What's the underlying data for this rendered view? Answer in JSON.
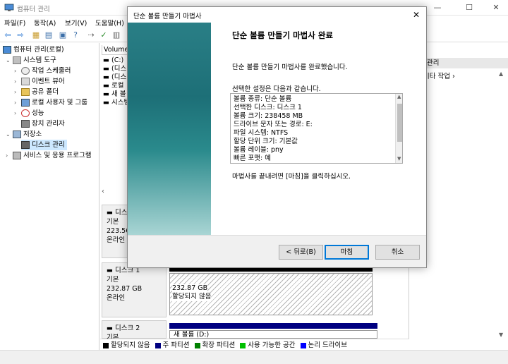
{
  "window": {
    "title": "컴퓨터 관리",
    "controls": [
      "—",
      "☐",
      "✕"
    ]
  },
  "menu": [
    "파일(F)",
    "동작(A)",
    "보기(V)",
    "도움말(H)"
  ],
  "tree": {
    "root": "컴퓨터 관리(로컬)",
    "system_tools": "시스템 도구",
    "task_scheduler": "작업 스케줄러",
    "event_viewer": "이벤트 뷰어",
    "shared_folders": "공유 폴더",
    "local_users": "로컬 사용자 및 그룹",
    "performance": "성능",
    "device_manager": "장치 관리자",
    "storage": "저장소",
    "disk_management": "디스크 관리",
    "services_apps": "서비스 및 응용 프로그램"
  },
  "center": {
    "volume_header": "Volume",
    "volumes": [
      "(C:)",
      "(디스",
      "(디스",
      "로컬",
      "새 볼",
      "시스템"
    ],
    "disk0": {
      "name": "디스",
      "type": "기본",
      "size": "223.56",
      "status": "온라인"
    },
    "disk1": {
      "name": "디스크 1",
      "type": "기본",
      "size": "232.87 GB",
      "status": "온라인",
      "part_size": "232.87 GB",
      "part_status": "할당되지 않음"
    },
    "disk2": {
      "name": "디스크 2",
      "type": "기본",
      "part_label": "새 볼륨  (D:)"
    }
  },
  "legend": [
    {
      "label": "할당되지 않음",
      "color": "#000000"
    },
    {
      "label": "주 파티션",
      "color": "#000080"
    },
    {
      "label": "확장 파티션",
      "color": "#008000"
    },
    {
      "label": "사용 가능한 공간",
      "color": "#00c000"
    },
    {
      "label": "논리 드라이브",
      "color": "#0000ff"
    }
  ],
  "actions": {
    "header": "관리",
    "more": "기타 작업"
  },
  "wizard": {
    "title": "단순 볼륨 만들기 마법사",
    "heading": "단순 볼륨 만들기 마법사 완료",
    "intro": "단순 볼륨 만들기 마법사를 완료했습니다.",
    "settings_label": "선택한 설정은 다음과 같습니다.",
    "settings": [
      "볼륨 종류: 단순 볼륨",
      "선택한 디스크: 디스크 1",
      "볼륨 크기: 238458 MB",
      "드라이브 문자 또는 경로: E:",
      "파일 시스템: NTFS",
      "할당 단위 크기: 기본값",
      "볼륨 레이블: pny",
      "빠른 포맷: 예"
    ],
    "note": "마법사를 끝내려면 [마침]을 클릭하십시오.",
    "back_label": "< 뒤로(B)",
    "finish_label": "마침",
    "cancel_label": "취소",
    "close": "✕"
  }
}
